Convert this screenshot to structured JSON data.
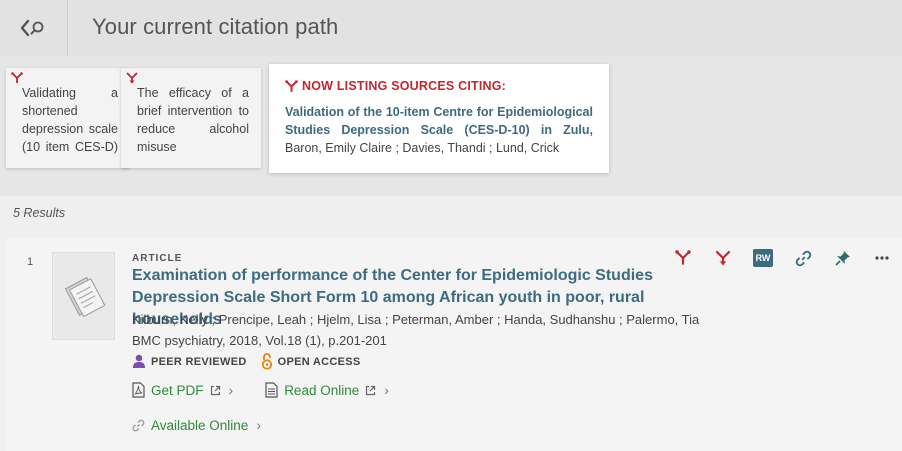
{
  "header": {
    "title": "Your current citation path"
  },
  "citation_path": {
    "cards": [
      {
        "text": "Validating a shortened depression scale (10 item CES-D) among HIV-positive people"
      },
      {
        "text": "The efficacy of a brief intervention to reduce alcohol misuse"
      }
    ],
    "current": {
      "label": "NOW LISTING SOURCES CITING:",
      "title": "Validation of the 10-item Centre for Epidemiological Studies Depression Scale (CES-D-10) in Zulu, Xhosa and Afrikaans populations",
      "authors": "Baron, Emily Claire ; Davies, Thandi ; Lund, Crick"
    }
  },
  "results": {
    "count_label": "5 Results",
    "items": [
      {
        "index": "1",
        "type": "ARTICLE",
        "title": "Examination of performance of the Center for Epidemiologic Studies Depression Scale Short Form 10 among African youth in poor, rural households",
        "authors": "Kilburn, Kelly ; Prencipe, Leah ; Hjelm, Lisa ; Peterman, Amber ; Handa, Sudhanshu ; Palermo, Tia",
        "source": "BMC psychiatry, 2018, Vol.18 (1), p.201-201",
        "badges": {
          "peer_reviewed": "PEER REVIEWED",
          "open_access": "OPEN ACCESS"
        },
        "links": {
          "pdf": "Get PDF",
          "read": "Read Online",
          "available": "Available Online"
        },
        "actions": {
          "rw": "RW"
        }
      }
    ]
  },
  "colors": {
    "accent_red": "#c4272b",
    "title_blue": "#3d6b80",
    "link_green": "#2f8a3a",
    "open_access_orange": "#e8870e",
    "peer_purple": "#7b4fb0"
  }
}
